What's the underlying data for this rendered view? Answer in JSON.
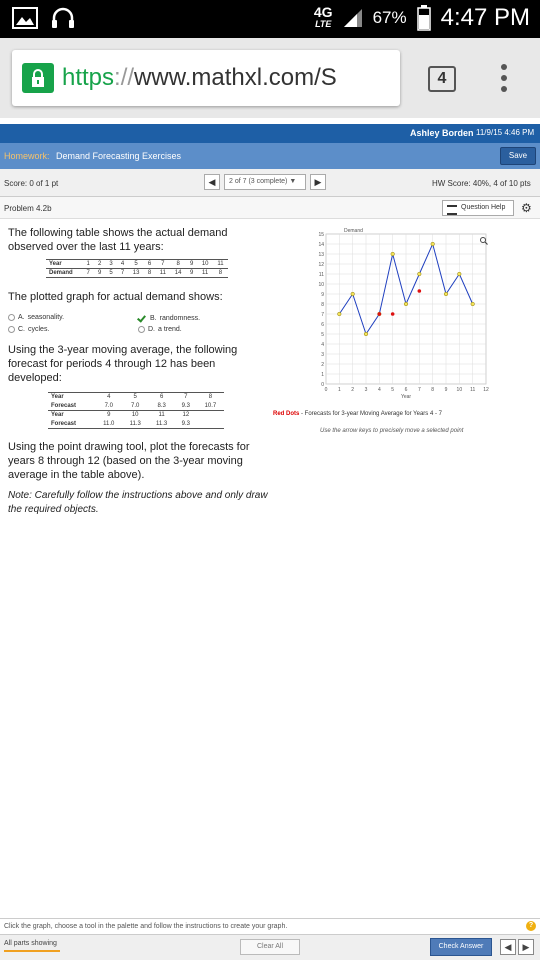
{
  "status_bar": {
    "network": "4G",
    "network_sub": "LTE",
    "battery": "67%",
    "time": "4:47 PM"
  },
  "browser": {
    "url_https": "https",
    "url_sep": "://",
    "url_rest": "www.mathxl.com/S",
    "tab_count": "4"
  },
  "header": {
    "user_name": "Ashley Borden",
    "date": "11/9/15 4:46 PM",
    "homework_label": "Homework:",
    "homework_title": "Demand Forecasting Exercises",
    "save_label": "Save"
  },
  "score_bar": {
    "score": "Score: 0 of 1 pt",
    "question_nav": "2 of 7 (3 complete)",
    "hw_score": "HW Score: 40%, 4 of 10 pts"
  },
  "problem_bar": {
    "problem": "Problem 4.2b",
    "question_help": "Question Help"
  },
  "question": {
    "intro": "The following table shows the actual demand observed over the last 11 years:",
    "demand_table": {
      "year_label": "Year",
      "demand_label": "Demand",
      "years": [
        "1",
        "2",
        "3",
        "4",
        "5",
        "6",
        "7",
        "8",
        "9",
        "10",
        "11"
      ],
      "demand": [
        "7",
        "9",
        "5",
        "7",
        "13",
        "8",
        "11",
        "14",
        "9",
        "11",
        "8"
      ]
    },
    "graph_question": "The plotted graph for actual demand shows:",
    "options": [
      {
        "letter": "A.",
        "text": "seasonality.",
        "selected": false
      },
      {
        "letter": "B.",
        "text": "randomness.",
        "selected": true
      },
      {
        "letter": "C.",
        "text": "cycles.",
        "selected": false
      },
      {
        "letter": "D.",
        "text": "a trend.",
        "selected": false
      }
    ],
    "moving_avg_text": "Using the 3-year moving average, the following forecast for periods 4 through 12 has been developed:",
    "forecast_table": {
      "year_label": "Year",
      "forecast_label": "Forecast",
      "row1_years": [
        "4",
        "5",
        "6",
        "7",
        "8"
      ],
      "row1_forecast": [
        "7.0",
        "7.0",
        "8.3",
        "9.3",
        "10.7"
      ],
      "row2_years": [
        "9",
        "10",
        "11",
        "12"
      ],
      "row2_forecast": [
        "11.0",
        "11.3",
        "11.3",
        "9.3"
      ]
    },
    "instruction": "Using the point drawing tool, plot the forecasts for years 8 through 12 (based on the 3-year moving average in the table above).",
    "note": "Note: Carefully follow the instructions above and only draw the required objects."
  },
  "chart_data": {
    "type": "line",
    "title": "Demand",
    "xlabel": "Year",
    "ylabel": "",
    "xlim": [
      0,
      12
    ],
    "ylim": [
      0,
      15
    ],
    "x_ticks": [
      "0",
      "1",
      "2",
      "3",
      "4",
      "5",
      "6",
      "7",
      "8",
      "9",
      "10",
      "11",
      "12"
    ],
    "y_ticks": [
      "0",
      "1",
      "2",
      "3",
      "4",
      "5",
      "6",
      "7",
      "8",
      "9",
      "10",
      "11",
      "12",
      "13",
      "14",
      "15"
    ],
    "grid": true,
    "series": [
      {
        "name": "",
        "color": "#1f3fbf",
        "x": [
          1,
          2,
          3,
          4,
          5,
          6,
          7,
          8,
          9,
          10,
          11
        ],
        "y": [
          7,
          9,
          5,
          7,
          13,
          8,
          11,
          14,
          9,
          11,
          8
        ]
      }
    ],
    "red_points": {
      "color": "#dd1111",
      "x": [
        4,
        5,
        7
      ],
      "y": [
        7,
        7,
        9.3
      ]
    }
  },
  "legend": {
    "red_label": "Red Dots",
    "text": " - Forecasts for 3-year Moving Average for Years 4 - 7",
    "arrow_note": "Use the arrow keys to precisely move a selected point"
  },
  "footer": {
    "hint": "Click the graph, choose a tool in the palette and follow the instructions to create your graph.",
    "all_parts": "All parts showing",
    "clear_all": "Clear All",
    "check_answer": "Check Answer"
  },
  "colors": {
    "header_blue": "#1e5fa6",
    "hw_blue": "#5c8ec9",
    "https_green": "#17a34a"
  }
}
